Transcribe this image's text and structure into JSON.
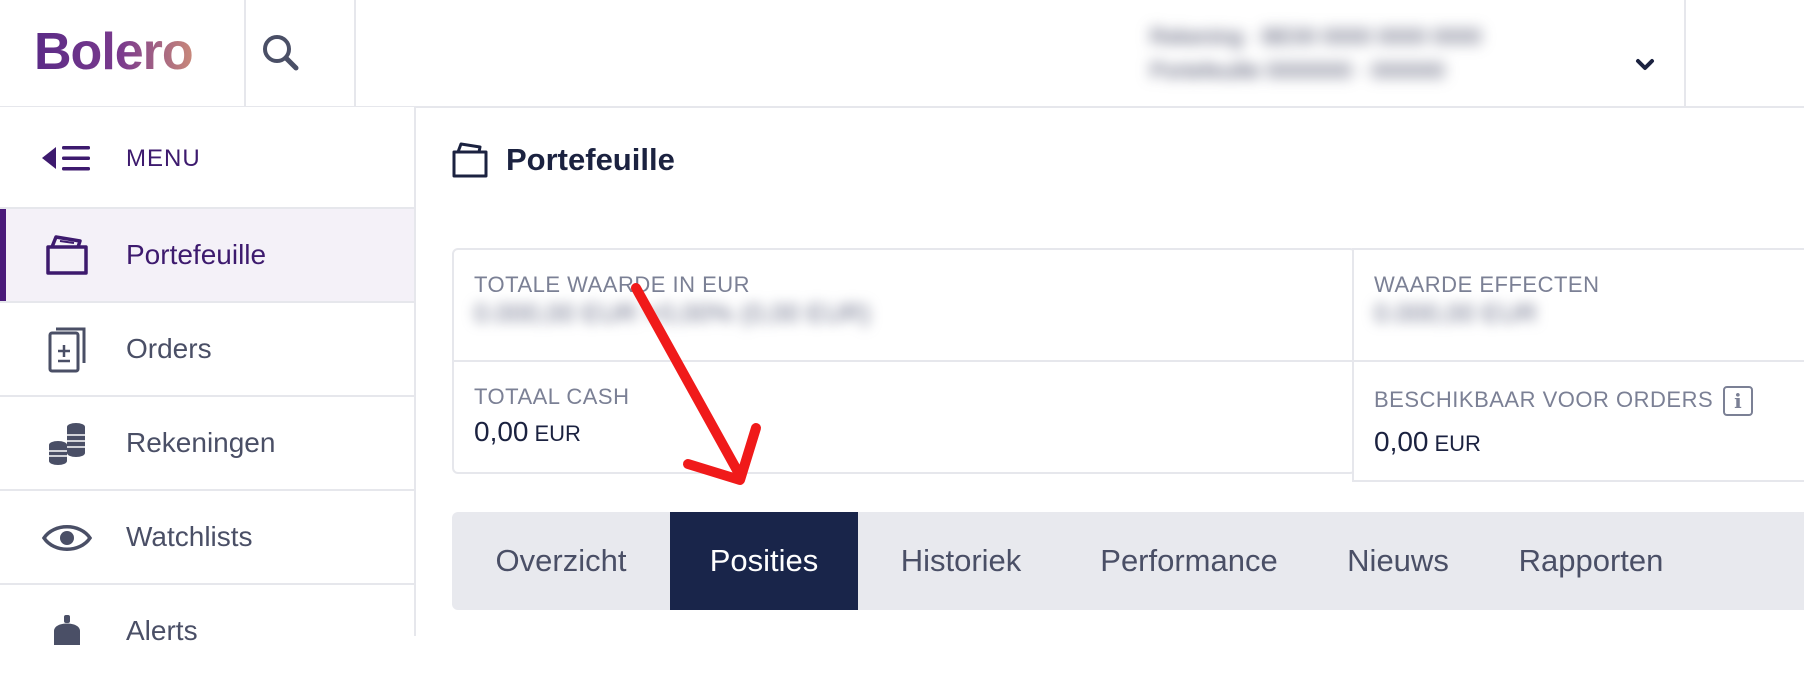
{
  "header": {
    "logo": "Bolero",
    "account_line1": "Rekening · BE00 0000 0000 0000",
    "account_line2": "Portefeuille 0000000 · 000000"
  },
  "sidebar": {
    "menu_label": "MENU",
    "items": [
      {
        "label": "Portefeuille",
        "icon": "wallet-icon",
        "active": true
      },
      {
        "label": "Orders",
        "icon": "orders-icon",
        "active": false
      },
      {
        "label": "Rekeningen",
        "icon": "coins-icon",
        "active": false
      },
      {
        "label": "Watchlists",
        "icon": "eye-icon",
        "active": false
      },
      {
        "label": "Alerts",
        "icon": "bell-icon",
        "active": false
      }
    ]
  },
  "page": {
    "title": "Portefeuille"
  },
  "summary": {
    "total_value_label": "TOTALE WAARDE IN EUR",
    "total_value_blurred": "0.000,00 EUR  +0,00% (0,00 EUR)",
    "securities_value_label": "WAARDE EFFECTEN",
    "securities_value_blurred": "0.000,00 EUR",
    "total_cash_label": "TOTAAL CASH",
    "total_cash_value": "0,00",
    "total_cash_unit": "EUR",
    "available_label": "BESCHIKBAAR VOOR ORDERS",
    "available_value": "0,00",
    "available_unit": "EUR",
    "info_glyph": "i"
  },
  "tabs": [
    {
      "label": "Overzicht",
      "active": false
    },
    {
      "label": "Posities",
      "active": true
    },
    {
      "label": "Historiek",
      "active": false
    },
    {
      "label": "Performance",
      "active": false
    },
    {
      "label": "Nieuws",
      "active": false
    },
    {
      "label": "Rapporten",
      "active": false
    }
  ],
  "colors": {
    "brand": "#4a1a7a",
    "active_tab": "#19254a",
    "annotation_arrow": "#f01a1a"
  }
}
